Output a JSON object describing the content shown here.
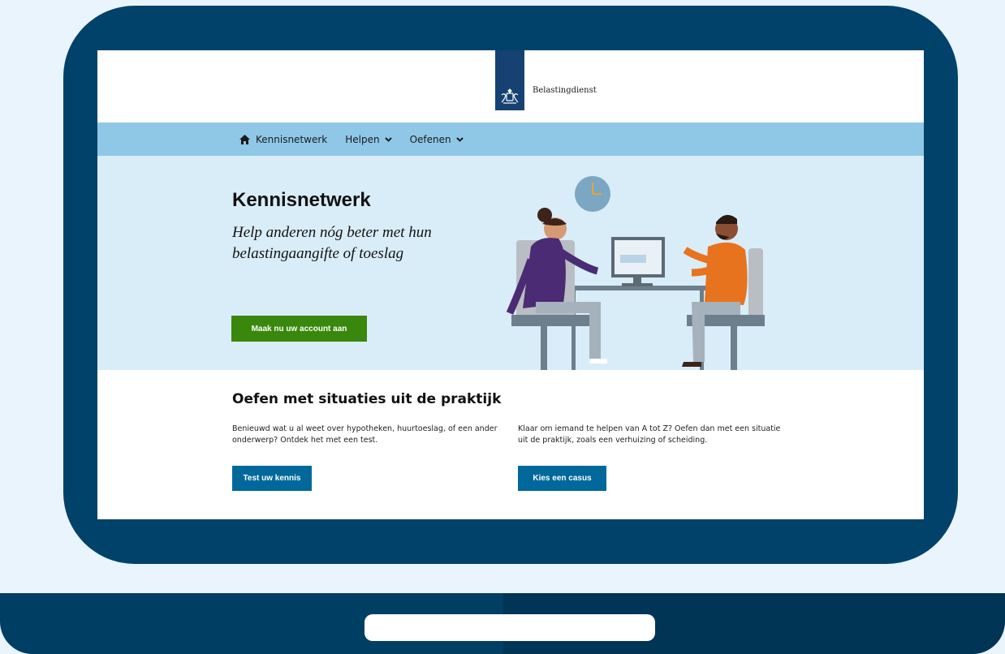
{
  "header": {
    "logo_text": "Belastingdienst"
  },
  "nav": {
    "items": [
      {
        "label": "Kennisnetwerk",
        "icon": "home-icon"
      },
      {
        "label": "Helpen",
        "icon": "chevron-down-icon"
      },
      {
        "label": "Oefenen",
        "icon": "chevron-down-icon"
      }
    ]
  },
  "hero": {
    "title": "Kennisnetwerk",
    "subtitle": "Help anderen nóg beter met hun belastingaangifte of toeslag",
    "cta_label": "Maak nu uw account aan"
  },
  "practice": {
    "title": "Oefen met situaties uit de praktijk",
    "left_text": "Benieuwd wat u al weet over hypotheken, huurtoeslag, of een ander onderwerp? Ontdek het met een test.",
    "left_button": "Test uw kennis",
    "right_text": "Klaar om iemand te helpen van A tot Z? Oefen dan met een situatie uit de praktijk, zoals een verhuizing of scheiding.",
    "right_button": "Kies een casus"
  },
  "colors": {
    "frame": "#01426a",
    "nav": "#8fc8e6",
    "hero": "#d9edf8",
    "green_button": "#39870c",
    "blue_button": "#01689b",
    "logo": "#154273"
  }
}
